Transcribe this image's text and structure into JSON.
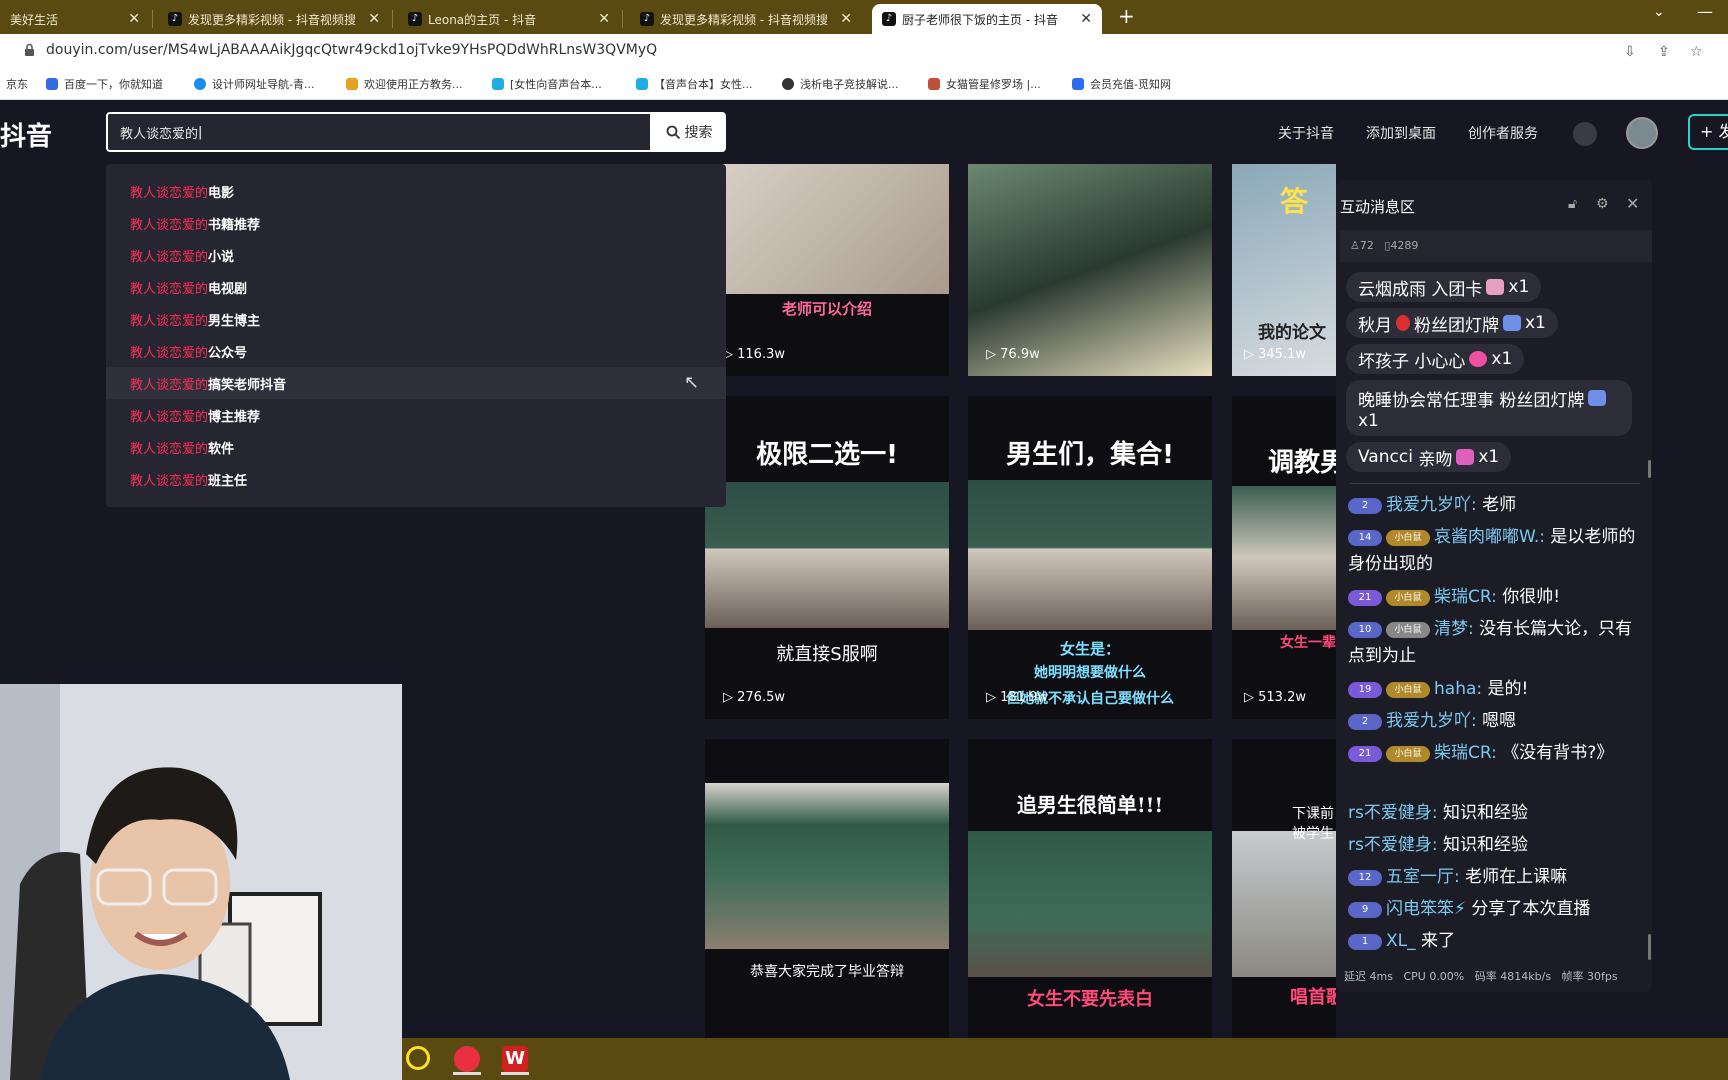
{
  "browser": {
    "tabs": [
      {
        "label": "美好生活",
        "active": false
      },
      {
        "label": "发现更多精彩视频 - 抖音视频搜",
        "active": false
      },
      {
        "label": "Leona的主页 - 抖音",
        "active": false
      },
      {
        "label": "发现更多精彩视频 - 抖音视频搜",
        "active": false
      },
      {
        "label": "厨子老师很下饭的主页 - 抖音",
        "active": true
      }
    ],
    "url": "douyin.com/user/MS4wLjABAAAAikJgqcQtwr49ckd1ojTvke9YHsPQDdWhRLnsW3QVMyQ",
    "bookmarks": [
      "京东",
      "百度一下，你就知道",
      "设计师网址导航-青...",
      "欢迎使用正方教务...",
      "[女性向音声台本...",
      "【音声台本】女性...",
      "浅析电子竞技解说...",
      "女猫管星修罗场 |...",
      "会员充值-觅知网"
    ]
  },
  "header": {
    "logo": "抖音",
    "search_value": "教人谈恋爱的",
    "search_button": "搜索",
    "nav": [
      "关于抖音",
      "添加到桌面",
      "创作者服务"
    ],
    "publish": "+ 发"
  },
  "suggestions": {
    "prefix": "教人谈恋爱的",
    "items": [
      "电影",
      "书籍推荐",
      "小说",
      "电视剧",
      "男生博主",
      "公众号",
      "搞笑老师抖音",
      "博主推荐",
      "软件",
      "班主任"
    ]
  },
  "videos": [
    {
      "plays": "116.3w",
      "caption": "老师可以介绍",
      "headline": ""
    },
    {
      "plays": "76.9w",
      "caption": "",
      "headline": ""
    },
    {
      "plays": "345.1w",
      "caption": "我的论文",
      "headline": "答"
    },
    {
      "plays": "276.5w",
      "caption": "就直接S服啊",
      "headline": "极限二选一!"
    },
    {
      "plays": "181.9w",
      "caption": "女生是：",
      "caption2": "她明明想要做什么",
      "caption3": "但她就不承认自己要做什么",
      "headline": "男生们，集合!"
    },
    {
      "plays": "513.2w",
      "caption": "女生一辈",
      "headline": "调教男"
    },
    {
      "plays": "",
      "caption": "恭喜大家完成了毕业答辩",
      "headline": ""
    },
    {
      "plays": "",
      "caption": "女生不要先表白",
      "headline": "追男生很简单!!!"
    },
    {
      "plays": "",
      "caption": "唱首歌吧老师",
      "headline": "下课前被学生"
    }
  ],
  "chat": {
    "title": "互动消息区",
    "stats_online": "72",
    "stats_total": "4289",
    "gifts": [
      {
        "user": "云烟成雨",
        "gift": "入团卡",
        "count": "x1"
      },
      {
        "user": "秋月",
        "gift": "粉丝团灯牌",
        "count": "x1"
      },
      {
        "user": "坏孩子",
        "gift": "小心心",
        "count": "x1"
      },
      {
        "user": "晚睡协会常任理事",
        "gift": "粉丝团灯牌",
        "count": "x1"
      },
      {
        "user": "Vancci",
        "gift": "亲吻",
        "count": "x1"
      }
    ],
    "messages": [
      {
        "level": "2",
        "fan": "",
        "user": "我爱九岁吖:",
        "text": "老师"
      },
      {
        "level": "14",
        "fan": "小白鼠",
        "user": "哀酱肉嘟嘟W.:",
        "text": "是以老师的身份出现的"
      },
      {
        "level": "21",
        "fan": "小白鼠",
        "user": "柴瑞CR:",
        "text": "你很帅!"
      },
      {
        "level": "10",
        "fan": "小白鼠",
        "user": "清梦:",
        "text": "没有长篇大论，只有点到为止"
      },
      {
        "level": "19",
        "fan": "小白鼠",
        "user": "haha:",
        "text": "是的!"
      },
      {
        "level": "2",
        "fan": "",
        "user": "我爱九岁吖:",
        "text": "嗯嗯"
      },
      {
        "level": "21",
        "fan": "小白鼠",
        "user": "柴瑞CR:",
        "text": "《没有背书?》"
      },
      {
        "level": "",
        "fan": "",
        "user": "rs不爱健身:",
        "text": "知识和经验"
      },
      {
        "level": "",
        "fan": "",
        "user": "rs不爱健身:",
        "text": "知识和经验"
      },
      {
        "level": "12",
        "fan": "",
        "user": "五室一厅:",
        "text": "老师在上课嘛"
      },
      {
        "level": "9",
        "fan": "",
        "user": "闪电笨笨⚡",
        "text": "分享了本次直播"
      },
      {
        "level": "1",
        "fan": "",
        "user": "XL_",
        "text": "来了"
      }
    ],
    "footer": {
      "latency": "延迟 4ms",
      "cpu": "CPU 0.00%",
      "bitrate": "码率 4814kb/s",
      "fps": "帧率 30fps"
    }
  },
  "colors": {
    "accent": "#fe2c55",
    "chrome": "#5a4a12",
    "background": "#161722",
    "publish_border": "#2bd4c9"
  },
  "icons": [
    "search-icon",
    "lock-icon",
    "close-icon",
    "plus-icon",
    "chevron-down-icon",
    "play-icon",
    "gear-icon",
    "user-icon"
  ]
}
